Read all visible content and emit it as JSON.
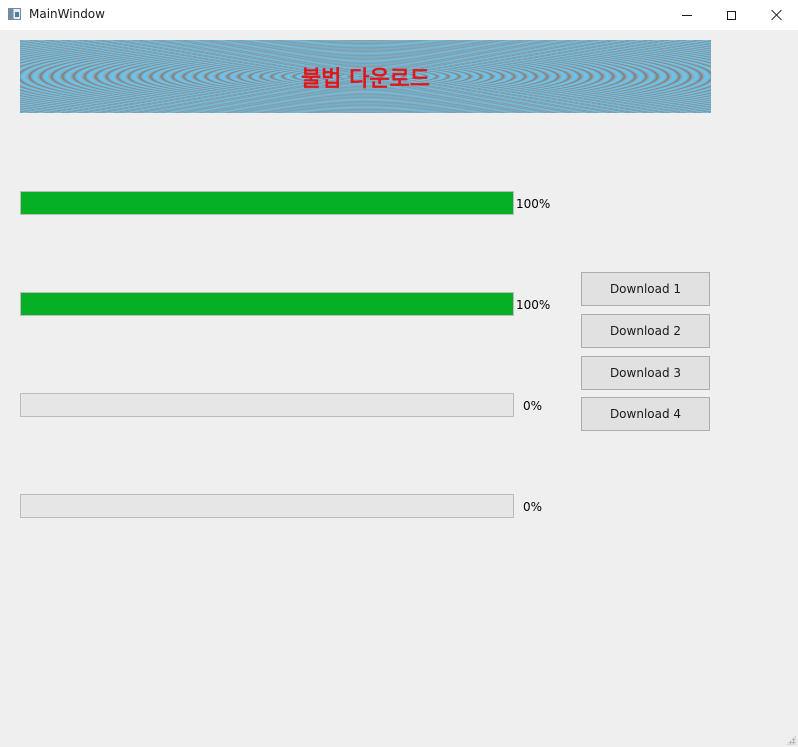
{
  "window": {
    "title": "MainWindow"
  },
  "banner": {
    "title": "불법 다운로드",
    "title_color": "#e0161b"
  },
  "downloads": [
    {
      "progress": 1.0,
      "label": "100%"
    },
    {
      "progress": 1.0,
      "label": "100%"
    },
    {
      "progress": 0.0,
      "label": "0%"
    },
    {
      "progress": 0.0,
      "label": "0%"
    }
  ],
  "buttons": [
    {
      "label": "Download 1"
    },
    {
      "label": "Download 2"
    },
    {
      "label": "Download 3"
    },
    {
      "label": "Download 4"
    }
  ],
  "colors": {
    "progress_fill": "#06b025",
    "background": "#efefef"
  }
}
